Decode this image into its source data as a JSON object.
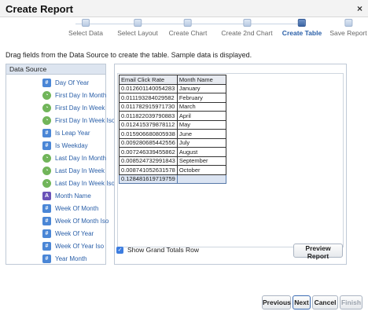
{
  "dialog": {
    "title": "Create Report",
    "close_glyph": "×"
  },
  "wizard": {
    "steps": [
      {
        "label": "Select Data"
      },
      {
        "label": "Select Layout"
      },
      {
        "label": "Create Chart"
      },
      {
        "label": "Create 2nd Chart"
      },
      {
        "label": "Create Table"
      },
      {
        "label": "Save Report"
      }
    ],
    "active_step": "Create Table"
  },
  "instructions": "Drag fields from the Data Source to create the table. Sample data is displayed.",
  "data_source": {
    "title": "Data Source",
    "items": [
      {
        "label": "Day Of Year",
        "type": "number",
        "icon": "number-icon"
      },
      {
        "label": "First Day In Month",
        "type": "date",
        "icon": "date-icon"
      },
      {
        "label": "First Day In Week",
        "type": "date",
        "icon": "date-icon"
      },
      {
        "label": "First Day In Week Iso",
        "type": "date",
        "icon": "date-icon"
      },
      {
        "label": "Is Leap Year",
        "type": "boolean",
        "icon": "boolean-icon"
      },
      {
        "label": "Is Weekday",
        "type": "boolean",
        "icon": "boolean-icon"
      },
      {
        "label": "Last Day In Month",
        "type": "date",
        "icon": "date-icon"
      },
      {
        "label": "Last Day In Week",
        "type": "date",
        "icon": "date-icon"
      },
      {
        "label": "Last Day In Week Iso",
        "type": "date",
        "icon": "date-icon"
      },
      {
        "label": "Month Name",
        "type": "text",
        "icon": "text-icon"
      },
      {
        "label": "Week Of Month",
        "type": "number",
        "icon": "number-icon"
      },
      {
        "label": "Week Of Month Iso",
        "type": "number",
        "icon": "number-icon"
      },
      {
        "label": "Week Of Year",
        "type": "number",
        "icon": "number-icon"
      },
      {
        "label": "Week Of Year Iso",
        "type": "number",
        "icon": "number-icon"
      },
      {
        "label": "Year Month",
        "type": "number",
        "icon": "number-icon"
      }
    ]
  },
  "table": {
    "headers": [
      "Email Click Rate",
      "Month Name"
    ],
    "rows": [
      [
        "0.012601140054283",
        "January"
      ],
      [
        "0.011193284029582",
        "February"
      ],
      [
        "0.011782915971730",
        "March"
      ],
      [
        "0.011822039790883",
        "April"
      ],
      [
        "0.012415379878112",
        "May"
      ],
      [
        "0.015906680805938",
        "June"
      ],
      [
        "0.009280685442556",
        "July"
      ],
      [
        "0.007246339455862",
        "August"
      ],
      [
        "0.008524732991843",
        "September"
      ],
      [
        "0.008741052631578",
        "October"
      ]
    ],
    "total_row": [
      "0.128481619719759",
      ""
    ]
  },
  "grand_totals": {
    "label": "Show Grand Totals Row",
    "checked": true
  },
  "buttons": {
    "preview": "Preview Report",
    "previous": "Previous",
    "next": "Next",
    "cancel": "Cancel",
    "finish": "Finish"
  },
  "colors": {
    "accent": "#2a5fa8",
    "panel_border": "#bfc9d6",
    "total_row_bg": "#dbe4f2",
    "checkbox": "#3d7de0"
  }
}
